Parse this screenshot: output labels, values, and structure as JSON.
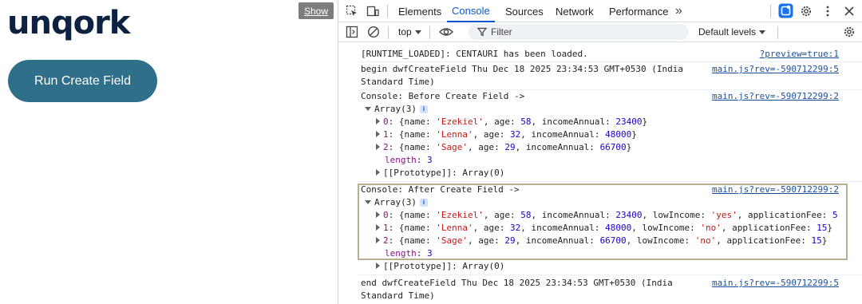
{
  "app": {
    "logo": "unqork",
    "run_button": "Run Create Field",
    "show_button": "Show"
  },
  "devtools": {
    "tabs": [
      "Elements",
      "Console",
      "Sources",
      "Network",
      "Performance"
    ],
    "more_tabs": "»",
    "context": "top",
    "filter_placeholder": "Filter",
    "levels": "Default levels"
  },
  "console": {
    "runtime_loaded": "[RUNTIME_LOADED]: CENTAURI has been loaded.",
    "runtime_src": "?preview=true:1",
    "begin_line1": "begin dwfCreateField Thu Dec 18 2025 23:34:53 GMT+0530 (India",
    "begin_line2": "Standard Time)",
    "begin_src": "main.js?rev=-590712299:5",
    "before_label": "Console: Before Create Field ->",
    "before_src": "main.js?rev=-590712299:2",
    "array_label": "Array(3)",
    "before_items": [
      {
        "idx": "0",
        "name": "'Ezekiel'",
        "age": "58",
        "income": "23400"
      },
      {
        "idx": "1",
        "name": "'Lenna'",
        "age": "32",
        "income": "48000"
      },
      {
        "idx": "2",
        "name": "'Sage'",
        "age": "29",
        "income": "66700"
      }
    ],
    "length_label": "length",
    "length_value": "3",
    "prototype": "[[Prototype]]: Array(0)",
    "after_label": "Console: After Create Field ->",
    "after_src": "main.js?rev=-590712299:2",
    "after_items": [
      {
        "idx": "0",
        "name": "'Ezekiel'",
        "age": "58",
        "income": "23400",
        "low": "'yes'",
        "fee": "5"
      },
      {
        "idx": "1",
        "name": "'Lenna'",
        "age": "32",
        "income": "48000",
        "low": "'no'",
        "fee": "15"
      },
      {
        "idx": "2",
        "name": "'Sage'",
        "age": "29",
        "income": "66700",
        "low": "'no'",
        "fee": "15"
      }
    ],
    "end_line1": "end dwfCreateField Thu Dec 18 2025 23:34:53 GMT+0530 (India",
    "end_line2": "Standard Time)",
    "end_src": "main.js?rev=-590712299:5"
  }
}
